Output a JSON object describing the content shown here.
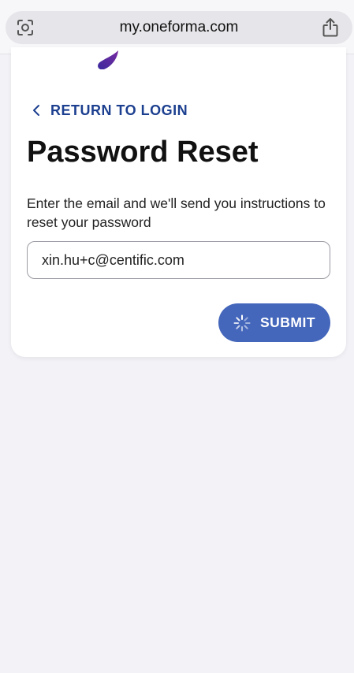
{
  "browser": {
    "url": "my.oneforma.com",
    "left_icon": "camera-scan-icon",
    "right_icon": "share-icon"
  },
  "page": {
    "logo_icon": "oneforma-logo-drop",
    "return_link": "RETURN TO LOGIN",
    "title": "Password Reset",
    "instructions": "Enter the email and we'll send you instructions to reset your password",
    "email_value": "xin.hu+c@centific.com",
    "submit_label": "SUBMIT",
    "submit_state": "loading"
  },
  "colors": {
    "accent": "#1c3f8f",
    "button": "#4466bb",
    "background": "#f2f2f7"
  }
}
